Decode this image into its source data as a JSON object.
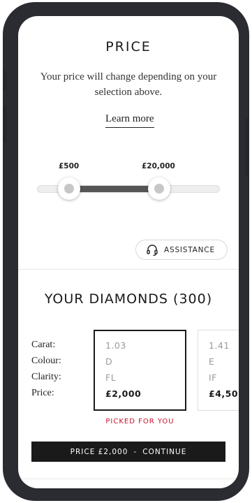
{
  "price_section": {
    "title": "PRICE",
    "description": "Your price will change depending on your selection above.",
    "learn_more": "Learn more",
    "slider": {
      "min_label": "£500",
      "max_label": "£20,000",
      "track_color": "#eeeeee",
      "fill_color": "#555555"
    },
    "assistance": {
      "label": "ASSISTANCE",
      "icon": "headset-icon"
    }
  },
  "diamonds_section": {
    "title": "YOUR DIAMONDS (300)",
    "spec_labels": [
      "Carat:",
      "Colour:",
      "Clarity:",
      "Price:"
    ],
    "cards": [
      {
        "carat": "1.03",
        "colour": "D",
        "clarity": "FL",
        "price": "£2,000",
        "selected": true
      },
      {
        "carat": "1.41",
        "colour": "E",
        "clarity": "IF",
        "price": "£4,50",
        "selected": false
      }
    ],
    "picked_label": "PICKED FOR YOU",
    "picked_color": "#c8102e"
  },
  "continue_button": {
    "price_text": "PRICE £2,000",
    "separator": "-",
    "action_text": "CONTINUE"
  }
}
